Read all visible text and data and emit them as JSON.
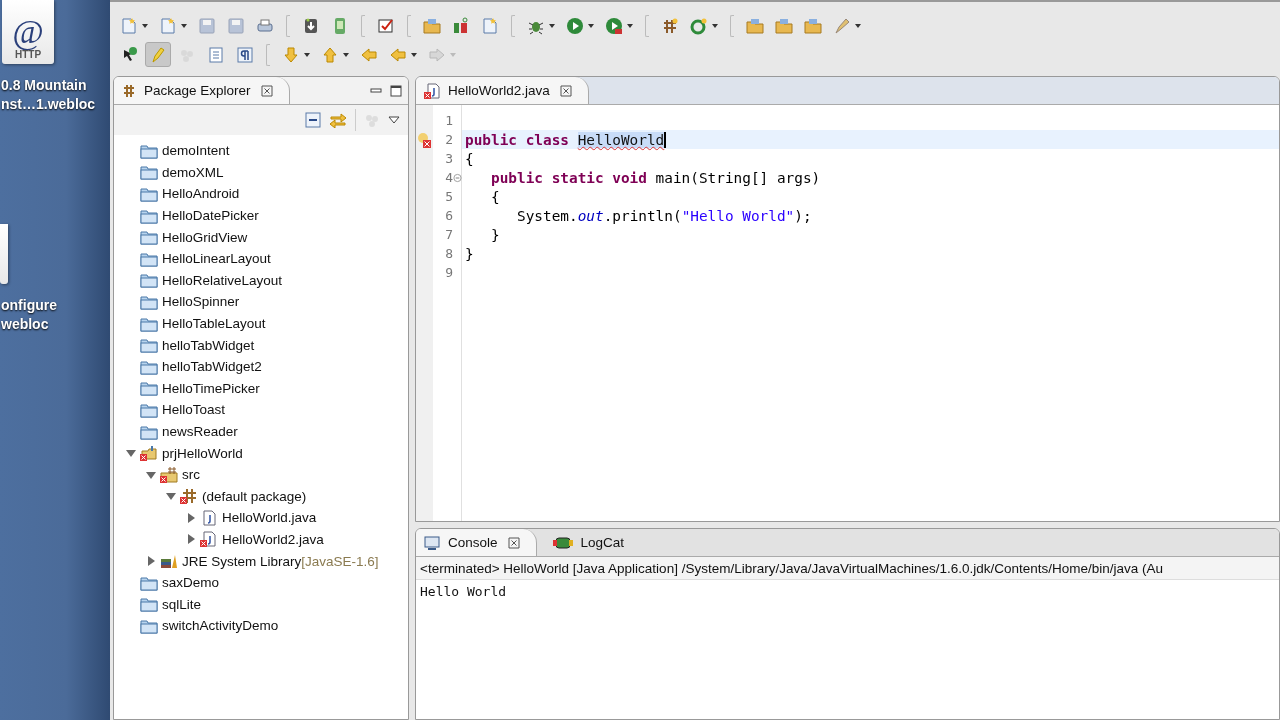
{
  "desktop": {
    "icons": [
      {
        "kind": "document",
        "badge": "@",
        "caption": "HTTP",
        "label_lines": [
          "0.8 Mountain",
          "nst…1.webloc"
        ]
      },
      {
        "kind": "document",
        "label_lines": [
          "onfigure",
          "webloc"
        ]
      }
    ]
  },
  "toolbar": {
    "rows": [
      [
        {
          "kind": "new",
          "dropdown": true,
          "disabled": false,
          "pressed": false
        },
        {
          "kind": "new-project",
          "dropdown": true,
          "disabled": false,
          "pressed": false
        },
        {
          "kind": "save",
          "dropdown": false,
          "disabled": true,
          "pressed": false
        },
        {
          "kind": "save-all",
          "dropdown": false,
          "disabled": true,
          "pressed": false
        },
        {
          "kind": "print",
          "dropdown": false,
          "disabled": false,
          "pressed": false
        },
        {
          "kind": "separator"
        },
        {
          "kind": "sdk-manager",
          "dropdown": false,
          "disabled": false,
          "pressed": false
        },
        {
          "kind": "avd",
          "dropdown": false,
          "disabled": false,
          "pressed": false
        },
        {
          "kind": "separator"
        },
        {
          "kind": "task",
          "dropdown": false,
          "disabled": false,
          "pressed": false
        },
        {
          "kind": "separator"
        },
        {
          "kind": "open-type",
          "dropdown": false,
          "disabled": false,
          "pressed": false
        },
        {
          "kind": "junit",
          "dropdown": false,
          "disabled": false,
          "pressed": false
        },
        {
          "kind": "new-file",
          "dropdown": false,
          "disabled": false,
          "pressed": false
        },
        {
          "kind": "separator"
        },
        {
          "kind": "debug",
          "dropdown": true,
          "disabled": false,
          "pressed": false
        },
        {
          "kind": "run",
          "dropdown": true,
          "disabled": false,
          "pressed": false
        },
        {
          "kind": "run-tools",
          "dropdown": true,
          "disabled": false,
          "pressed": false
        },
        {
          "kind": "separator"
        },
        {
          "kind": "new-package",
          "dropdown": false,
          "disabled": false,
          "pressed": false
        },
        {
          "kind": "new-class",
          "dropdown": true,
          "disabled": false,
          "pressed": false
        },
        {
          "kind": "separator"
        },
        {
          "kind": "open-folder",
          "dropdown": false,
          "disabled": false,
          "pressed": false
        },
        {
          "kind": "open-project",
          "dropdown": false,
          "disabled": false,
          "pressed": false
        },
        {
          "kind": "open-archive",
          "dropdown": false,
          "disabled": false,
          "pressed": false
        },
        {
          "kind": "pin",
          "dropdown": true,
          "disabled": false,
          "pressed": false
        }
      ],
      [
        {
          "kind": "hierarchy",
          "dropdown": false,
          "disabled": false,
          "pressed": false
        },
        {
          "kind": "highlight",
          "dropdown": false,
          "disabled": false,
          "pressed": true
        },
        {
          "kind": "occurrences",
          "dropdown": false,
          "disabled": true,
          "pressed": false
        },
        {
          "kind": "block",
          "dropdown": false,
          "disabled": false,
          "pressed": false
        },
        {
          "kind": "pilcrow",
          "dropdown": false,
          "disabled": false,
          "pressed": false
        },
        {
          "kind": "separator"
        },
        {
          "kind": "next-annotation",
          "dropdown": true,
          "disabled": false,
          "pressed": false
        },
        {
          "kind": "prev-annotation",
          "dropdown": true,
          "disabled": false,
          "pressed": false
        },
        {
          "kind": "last-edit",
          "dropdown": false,
          "disabled": false,
          "pressed": false
        },
        {
          "kind": "back",
          "dropdown": true,
          "disabled": false,
          "pressed": false
        },
        {
          "kind": "forward",
          "dropdown": true,
          "disabled": true,
          "pressed": false
        }
      ]
    ]
  },
  "package_explorer": {
    "tab": {
      "label": "Package Explorer",
      "selected": true
    },
    "tree": [
      {
        "label": "demoIntent",
        "kind": "project",
        "error": false
      },
      {
        "label": "demoXML",
        "kind": "project",
        "error": false
      },
      {
        "label": "HelloAndroid",
        "kind": "project",
        "error": false
      },
      {
        "label": "HelloDatePicker",
        "kind": "project",
        "error": false
      },
      {
        "label": "HelloGridView",
        "kind": "project",
        "error": false
      },
      {
        "label": "HelloLinearLayout",
        "kind": "project",
        "error": false
      },
      {
        "label": "HelloRelativeLayout",
        "kind": "project",
        "error": false
      },
      {
        "label": "HelloSpinner",
        "kind": "project",
        "error": false
      },
      {
        "label": "HelloTableLayout",
        "kind": "project",
        "error": false
      },
      {
        "label": "helloTabWidget",
        "kind": "project",
        "error": false
      },
      {
        "label": "helloTabWidget2",
        "kind": "project",
        "error": false
      },
      {
        "label": "HelloTimePicker",
        "kind": "project",
        "error": false
      },
      {
        "label": "HelloToast",
        "kind": "project",
        "error": false
      },
      {
        "label": "newsReader",
        "kind": "project",
        "error": false
      },
      {
        "label": "prjHelloWorld",
        "kind": "open-project",
        "error": true,
        "expanded": true,
        "children": [
          {
            "label": "src",
            "kind": "source-folder",
            "error": true,
            "expanded": true,
            "children": [
              {
                "label": "(default package)",
                "kind": "package",
                "error": true,
                "expanded": true,
                "children": [
                  {
                    "label": "HelloWorld.java",
                    "kind": "java-file",
                    "error": false,
                    "expanded": false
                  },
                  {
                    "label": "HelloWorld2.java",
                    "kind": "java-file",
                    "error": true,
                    "expanded": false
                  }
                ]
              }
            ]
          },
          {
            "label": "JRE System Library",
            "decoration": "[JavaSE-1.6]",
            "kind": "library",
            "error": false,
            "expanded": false
          }
        ]
      },
      {
        "label": "saxDemo",
        "kind": "project",
        "error": false
      },
      {
        "label": "sqlLite",
        "kind": "project",
        "error": false
      },
      {
        "label": "switchActivityDemo",
        "kind": "project",
        "error": false
      }
    ]
  },
  "editor": {
    "tab": {
      "label": "HelloWorld2.java",
      "selected": true,
      "error": true
    },
    "lines": [
      {
        "number": "1",
        "current": false,
        "error": false,
        "fold": false
      },
      {
        "number": "2",
        "current": true,
        "error": true,
        "fold": false,
        "tokens": [
          {
            "text": "public class ",
            "kind": "keyword"
          },
          {
            "text": "HelloWorld",
            "kind": "error-selected"
          }
        ]
      },
      {
        "number": "3",
        "current": false,
        "error": false,
        "fold": false,
        "tokens": [
          {
            "text": "{",
            "kind": "plain"
          }
        ]
      },
      {
        "number": "4",
        "current": false,
        "error": false,
        "fold": true,
        "tokens": [
          {
            "text": "   public static void",
            "kind": "keyword"
          },
          {
            "text": " main(String[] args)",
            "kind": "plain"
          }
        ]
      },
      {
        "number": "5",
        "current": false,
        "error": false,
        "fold": false,
        "tokens": [
          {
            "text": "   {",
            "kind": "plain"
          }
        ]
      },
      {
        "number": "6",
        "current": false,
        "error": false,
        "fold": false,
        "tokens": [
          {
            "text": "      System.",
            "kind": "plain"
          },
          {
            "text": "out",
            "kind": "field"
          },
          {
            "text": ".println(",
            "kind": "plain"
          },
          {
            "text": "\"Hello World\"",
            "kind": "string"
          },
          {
            "text": ");",
            "kind": "plain"
          }
        ]
      },
      {
        "number": "7",
        "current": false,
        "error": false,
        "fold": false,
        "tokens": [
          {
            "text": "   }",
            "kind": "plain"
          }
        ]
      },
      {
        "number": "8",
        "current": false,
        "error": false,
        "fold": false,
        "tokens": [
          {
            "text": "}",
            "kind": "plain"
          }
        ]
      },
      {
        "number": "9",
        "current": false,
        "error": false,
        "fold": false
      }
    ]
  },
  "console": {
    "tabs": [
      {
        "label": "Console",
        "kind": "console",
        "selected": true
      },
      {
        "label": "LogCat",
        "kind": "logcat",
        "selected": false
      }
    ],
    "header": "<terminated> HelloWorld [Java Application] /System/Library/Java/JavaVirtualMachines/1.6.0.jdk/Contents/Home/bin/java (Au",
    "output": "Hello World"
  }
}
